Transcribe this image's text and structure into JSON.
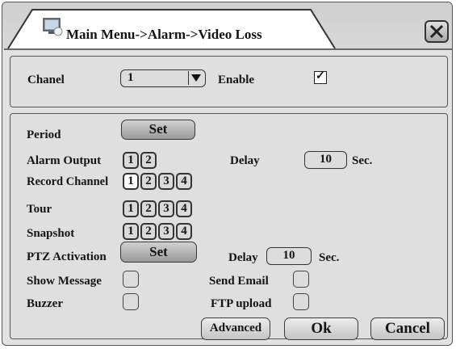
{
  "window": {
    "title": "Main Menu->Alarm->Video Loss",
    "close_icon": "close-icon",
    "title_icon": "monitor-icon"
  },
  "top": {
    "chanel_label": "Chanel",
    "chanel_value": "1",
    "enable_label": "Enable",
    "enable_checked": true,
    "check_glyph": "✓"
  },
  "rows": {
    "period_label": "Period",
    "set_label": "Set",
    "alarm_output_label": "Alarm Output",
    "alarm_output_channels": [
      "1",
      "2"
    ],
    "delay_label": "Delay",
    "delay_value": "10",
    "sec_label": "Sec.",
    "record_channel_label": "Record Channel",
    "record_channels": [
      "1",
      "2",
      "3",
      "4"
    ],
    "tour_label": "Tour",
    "tour_channels": [
      "1",
      "2",
      "3",
      "4"
    ],
    "snapshot_label": "Snapshot",
    "snapshot_channels": [
      "1",
      "2",
      "3",
      "4"
    ],
    "ptz_label": "PTZ Activation",
    "ptz_set_label": "Set",
    "ptz_delay_label": "Delay",
    "ptz_delay_value": "10",
    "ptz_sec_label": "Sec.",
    "show_message_label": "Show Message",
    "send_email_label": "Send Email",
    "buzzer_label": "Buzzer",
    "ftp_upload_label": "FTP upload"
  },
  "buttons": {
    "advanced": "Advanced",
    "ok": "Ok",
    "cancel": "Cancel"
  }
}
